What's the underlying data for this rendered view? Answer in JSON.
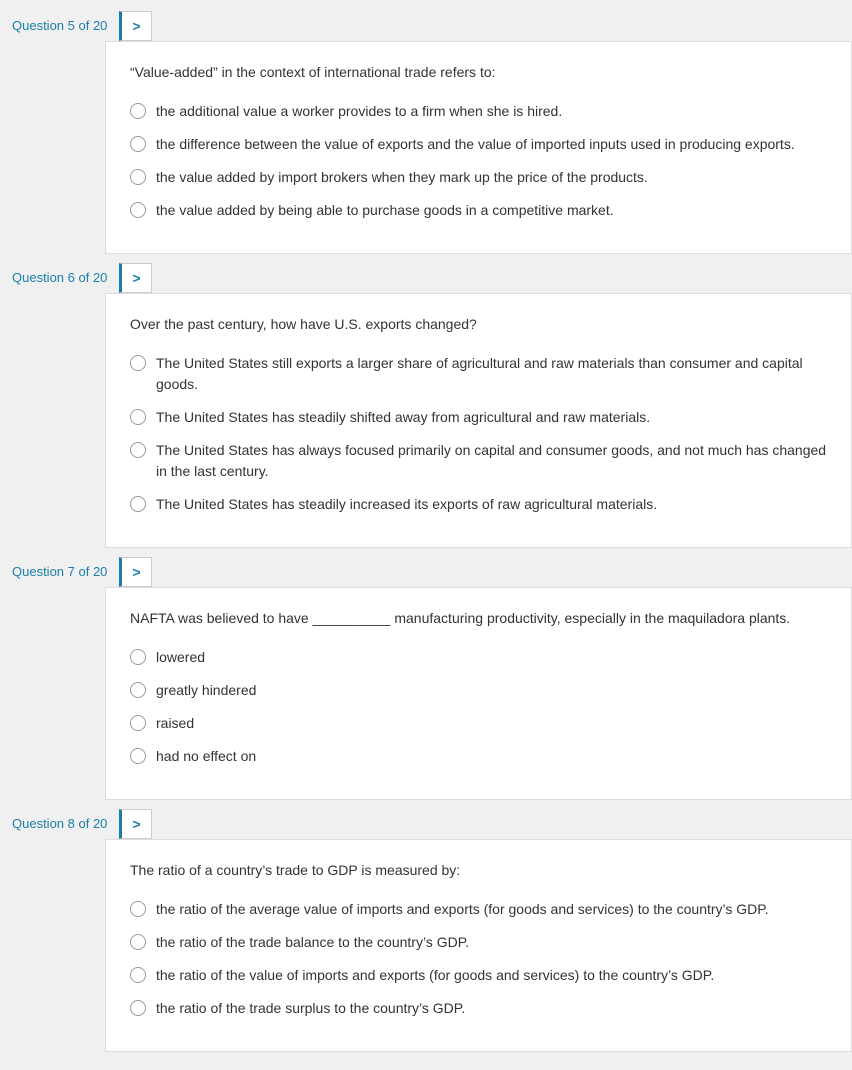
{
  "questions": [
    {
      "id": "q5",
      "label": "Question 5 of 20",
      "text": "“Value-added” in the context of international trade refers to:",
      "options": [
        "the additional value a worker provides to a firm when she is hired.",
        "the difference between the value of exports and the value of imported inputs used in producing exports.",
        "the value added by import brokers when they mark up the price of the products.",
        "the value added by being able to purchase goods in a competitive market."
      ]
    },
    {
      "id": "q6",
      "label": "Question 6 of 20",
      "text": "Over the past century, how have U.S. exports changed?",
      "options": [
        "The United States still exports a larger share of agricultural and raw materials than consumer and capital goods.",
        "The United States has steadily shifted away from agricultural and raw materials.",
        "The United States has always focused primarily on capital and consumer goods, and not much has changed in the last century.",
        "The United States has steadily increased its exports of raw agricultural materials."
      ]
    },
    {
      "id": "q7",
      "label": "Question 7 of 20",
      "text": "NAFTA was believed to have __________ manufacturing productivity, especially in the maquiladora plants.",
      "options": [
        "lowered",
        "greatly hindered",
        "raised",
        "had no effect on"
      ]
    },
    {
      "id": "q8",
      "label": "Question 8 of 20",
      "text": "The ratio of a country’s trade to GDP is measured by:",
      "options": [
        "the ratio of the average value of imports and exports (for goods and services) to the country’s GDP.",
        "the ratio of the trade balance to the country’s GDP.",
        "the ratio of the value of imports and exports (for goods and services) to the country’s GDP.",
        "the ratio of the trade surplus to the country’s GDP."
      ]
    }
  ],
  "arrow_label": ">"
}
